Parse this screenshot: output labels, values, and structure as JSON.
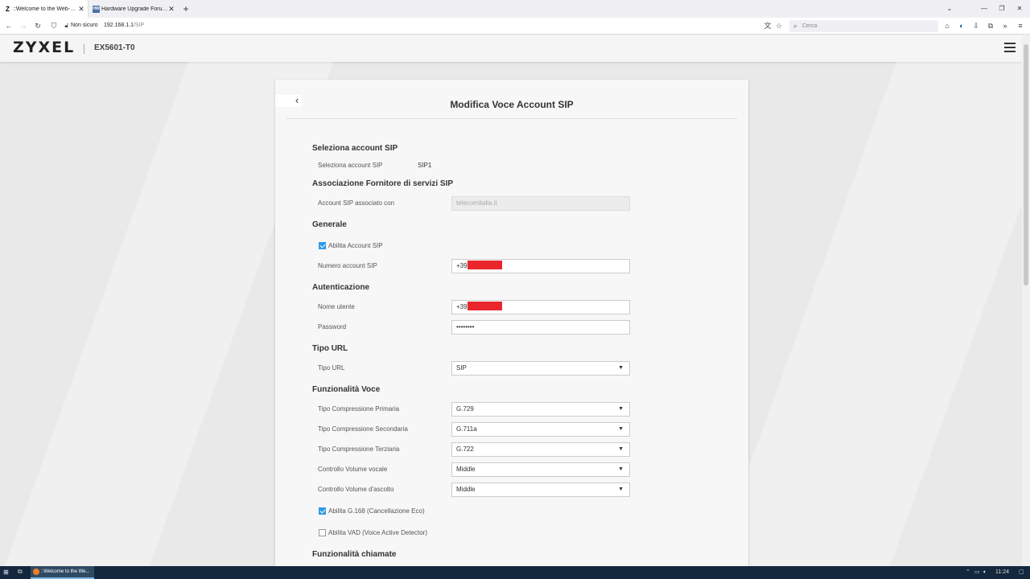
{
  "browser": {
    "tabs": [
      {
        "favicon": "Z",
        "label": "::Welcome to the Web-Based C",
        "active": true
      },
      {
        "favicon": "HW",
        "label": "Hardware Upgrade Forum - Re",
        "active": false
      }
    ],
    "new_tab": "+",
    "not_secure": "Non sicuro",
    "url_host": "192.168.1.1",
    "url_path": "/SIP",
    "search_placeholder": "Cerca"
  },
  "router": {
    "brand": "ZYXEL",
    "model": "EX5601-T0"
  },
  "card": {
    "title": "Modifica Voce Account SIP",
    "sections": {
      "select_account": "Seleziona account SIP",
      "provider": "Associazione Fornitore di servizi SIP",
      "general": "Generale",
      "auth": "Autenticazione",
      "url_type": "Tipo URL",
      "voice": "Funzionalità Voce",
      "calls": "Funzionalità chiamate"
    },
    "select_account": {
      "label": "Seleziona account SIP",
      "value": "SIP1"
    },
    "provider": {
      "label": "Account SIP associato con",
      "value": "telecomitalia.it"
    },
    "general": {
      "enable_label": "Abilita Account SIP",
      "enable_checked": true,
      "number_label": "Numero account SIP",
      "number_prefix": "+39"
    },
    "auth": {
      "username_label": "Nome utente",
      "username_prefix": "+39",
      "password_label": "Password",
      "password_value": "••••••••"
    },
    "url_type": {
      "label": "Tipo URL",
      "value": "SIP"
    },
    "voice": {
      "primary_label": "Tipo Compressione Primaria",
      "primary_value": "G.729",
      "secondary_label": "Tipo Compressione Secondaria",
      "secondary_value": "G.711a",
      "tertiary_label": "Tipo Compressione Terziaria",
      "tertiary_value": "G.722",
      "voice_vol_label": "Controllo Volume vocale",
      "voice_vol_value": "Middle",
      "listen_vol_label": "Controllo Volume d'ascolto",
      "listen_vol_value": "Middle",
      "g168_label": "Abilita G.168 (Cancellazione Eco)",
      "g168_checked": true,
      "vad_label": "Abilita VAD (Voice Active Detector)",
      "vad_checked": false
    }
  },
  "taskbar": {
    "app_label": "::Welcome to the We...",
    "time": "11:24"
  },
  "colors": {
    "accent": "#2e9ae6",
    "redaction": "#e8262b",
    "taskbar": "#13283d"
  }
}
